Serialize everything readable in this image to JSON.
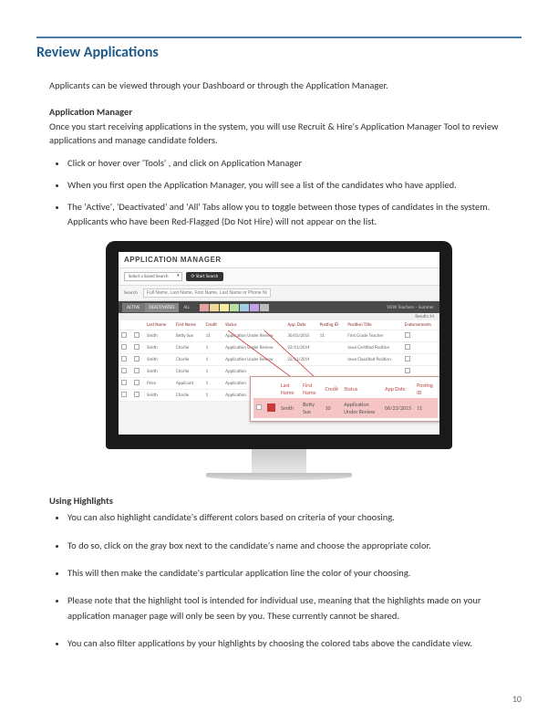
{
  "title": "Review Applications",
  "intro": "Applicants can be viewed through your Dashboard or through the Application Manager.",
  "section1": {
    "heading": "Application Manager",
    "desc": "Once you start receiving applications in the system, you will use Recruit & Hire's Application Manager Tool to review applications and manage candidate folders.",
    "bullets": [
      "Click or hover over 'Tools' , and click on Application Manager",
      "When you first open the Application Manager, you will see a list of the candidates who have applied.",
      "The 'Active', 'Deactivated' and 'All' Tabs allow you to toggle between those types of candidates in the system. Applicants who have been Red-Flagged (Do Not Hire) will not appear on the list."
    ]
  },
  "app": {
    "title": "APPLICATION MANAGER",
    "savedSearch": "Select a Saved Search",
    "searchBtn": "Start Search",
    "searchLabel": "Search",
    "searchPlaceholder": "Full Name, Last Name, First Name, Last Name or Phone No.",
    "tabs": {
      "active": "ACTIVE",
      "deactivated": "DEACTIVATED",
      "all": "ALL"
    },
    "viewLabel": "VIEW",
    "viewValue": "Teachers – Summer",
    "resultsLabel": "Results 14",
    "columns": [
      "",
      "",
      "Last Name",
      "First Name",
      "Credit",
      "Status",
      "App. Date",
      "Posting ID",
      "Position Title",
      "Endorsements"
    ],
    "rows": [
      {
        "last": "Smith",
        "first": "Betty Sue",
        "credit": "11",
        "status": "Application Under Review",
        "date": "30/03/2015",
        "pid": "11",
        "ptitle": "First Grade Teacher"
      },
      {
        "last": "Smith",
        "first": "Charlie",
        "credit": "1",
        "status": "Application Under Review",
        "date": "22/11/2014",
        "pid": "",
        "ptitle": "Iowa Certified Position"
      },
      {
        "last": "Smith",
        "first": "Charlie",
        "credit": "1",
        "status": "Application Under Review",
        "date": "22/11/2014",
        "pid": "",
        "ptitle": "Iowa Classified Position"
      },
      {
        "last": "Smith",
        "first": "Charlie",
        "credit": "1",
        "status": "Application",
        "date": "",
        "pid": "",
        "ptitle": ""
      },
      {
        "last": "Price",
        "first": "Applicant",
        "credit": "1",
        "status": "Application",
        "date": "",
        "pid": "",
        "ptitle": ""
      },
      {
        "last": "Smith",
        "first": "Charlie",
        "credit": "1",
        "status": "Application",
        "date": "",
        "pid": "",
        "ptitle": ""
      }
    ],
    "callout": {
      "columns": [
        "",
        "",
        "Last Name",
        "First Name",
        "Credit",
        "Status",
        "App Date",
        "Posting ID"
      ],
      "row": {
        "last": "Smith",
        "first": "Betty Sue",
        "credit": "10",
        "status": "Application Under Review",
        "date": "06/23/2015",
        "posting": "11"
      }
    }
  },
  "section2": {
    "heading": "Using Highlights",
    "bullets": [
      "You can also highlight candidate's different colors based on criteria of your choosing.",
      "To do so, click on the gray box next to the candidate's name and choose the appropriate color.",
      "This will then make the candidate's particular application line the color of your choosing.",
      "Please note that the highlight tool is intended for individual use, meaning that the highlights made on your application manager page will only be seen by you. These currently cannot be shared.",
      "You can also filter applications by your highlights by choosing the colored tabs above the candidate view."
    ]
  },
  "pageNumber": "10"
}
